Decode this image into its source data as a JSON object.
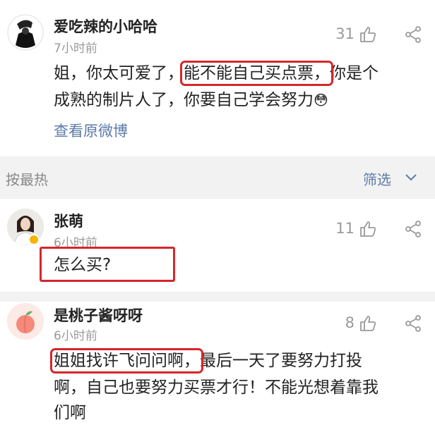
{
  "comments": [
    {
      "username": "爱吃辣的小哈哈",
      "time": "7小时前",
      "likes": "31",
      "text_line1_a": "姐，你太可爱了，",
      "text_line1_b": "能不能自己买点票，",
      "text_line1_c": "你是个",
      "text_line2": "成熟的制片人了，你要自己学会努力",
      "emoji": "😳",
      "link": "查看原微博"
    },
    {
      "username": "张萌",
      "time": "6小时前",
      "likes": "11",
      "text": "怎么买?"
    },
    {
      "username": "是桃子酱呀呀",
      "time": "6小时前",
      "likes": "8",
      "text_line1_a": "姐姐找许飞问问啊，",
      "text_line1_b": "最后一天了要努力打投",
      "text_line2": "啊，自己也要努力买票才行！不能光想着靠我",
      "text_line3": "们啊"
    }
  ],
  "sortbar": {
    "sort_label": "按最热",
    "filter_label": "筛选"
  },
  "colors": {
    "highlight_box": "#d6262b",
    "link": "#5b7ba8",
    "muted": "#9a9a9a",
    "sortbar_bg": "#f2f2f2"
  }
}
